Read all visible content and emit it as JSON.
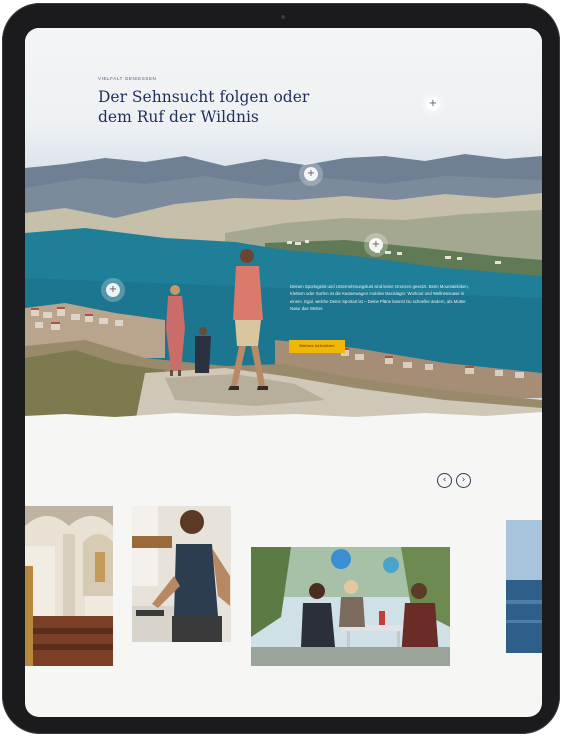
{
  "hero": {
    "eyebrow": "Vielfalt geniessen",
    "headline_line1": "Der Sehnsucht folgen oder",
    "headline_line2": "dem Ruf der Wildnis",
    "hotspot_symbol": "+",
    "copy": "Deinen Sportsgeist und Unternehmungslust sind keine Grenzen gesetzt. Beim Mountainbiken, Klettern oder Surfen ist die Kastenwagen mobiles Basislager. Workout und Wellnessoase in einem. Egal, welche Deine Sportart ist – Deine Pläne kannst Du schneller ändern, als Mutter Natur das Wetter.",
    "cta_label": "Weitere Aktivitäten"
  },
  "carousel": {
    "prev_symbol": "‹",
    "next_symbol": "›"
  },
  "colors": {
    "headline": "#1f2f5a",
    "cta": "#f2b705",
    "sea": "#1f7f98",
    "device": "#1b1b1d"
  }
}
